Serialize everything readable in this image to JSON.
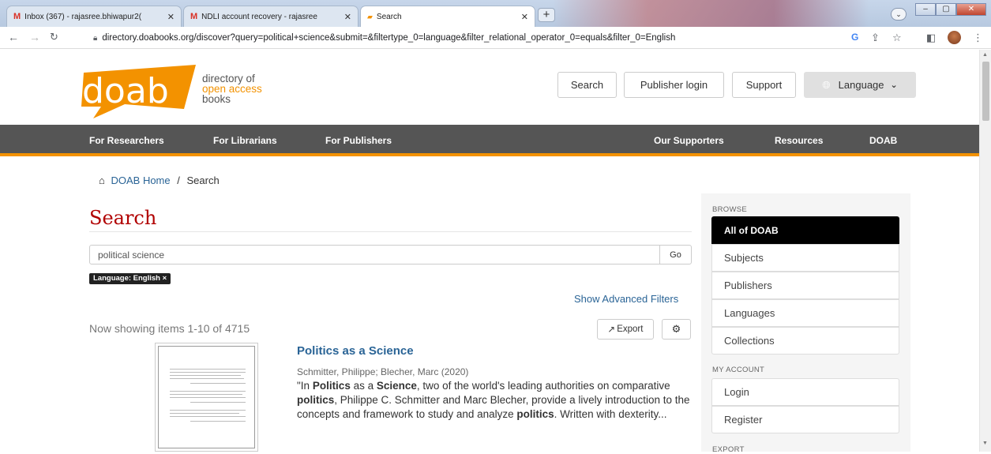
{
  "browser": {
    "tabs": [
      {
        "icon": "gmail-icon",
        "label": "Inbox (367) - rajasree.bhiwapur2(",
        "close": "✕"
      },
      {
        "icon": "gmail-icon",
        "label": "NDLI account recovery - rajasree",
        "close": "✕"
      },
      {
        "icon": "doab-favicon",
        "label": "Search",
        "close": "✕"
      }
    ],
    "new_tab": "+",
    "url": "directory.doabooks.org/discover?query=political+science&submit=&filtertype_0=language&filter_relational_operator_0=equals&filter_0=English"
  },
  "logo": {
    "wordmark": "doab",
    "line1": "directory of",
    "line2": "open access",
    "line3": "books",
    "color": "#f39200"
  },
  "header": {
    "search": "Search",
    "publisher_login": "Publisher login",
    "support": "Support",
    "language": "Language"
  },
  "nav": {
    "researchers": "For Researchers",
    "librarians": "For Librarians",
    "publishers": "For Publishers",
    "supporters": "Our Supporters",
    "resources": "Resources",
    "doab": "DOAB"
  },
  "breadcrumb": {
    "home": "DOAB Home",
    "sep": "/",
    "current": "Search"
  },
  "main": {
    "title": "Search",
    "query": "political science",
    "go": "Go",
    "filter_badge": "Language: English ×",
    "advanced": "Show Advanced Filters",
    "showing": "Now showing items 1-10 of 4715",
    "export": "Export"
  },
  "result": {
    "title": "Politics as a Science",
    "author": "Schmitter, Philippe; Blecher, Marc (2020)",
    "abstract_parts": [
      {
        "t": "\"In ",
        "b": false
      },
      {
        "t": "Politics",
        "b": true
      },
      {
        "t": " as a ",
        "b": false
      },
      {
        "t": "Science",
        "b": true
      },
      {
        "t": ", two of the world's leading authorities on comparative ",
        "b": false
      },
      {
        "t": "politics",
        "b": true
      },
      {
        "t": ", Philippe C. Schmitter and Marc Blecher, provide a lively introduction to the concepts and framework to study and analyze ",
        "b": false
      },
      {
        "t": "politics",
        "b": true
      },
      {
        "t": ". Written with dexterity...",
        "b": false
      }
    ]
  },
  "sidebar": {
    "browse_head": "BROWSE",
    "browse": [
      "All of DOAB",
      "Subjects",
      "Publishers",
      "Languages",
      "Collections"
    ],
    "account_head": "MY ACCOUNT",
    "account": [
      "Login",
      "Register"
    ],
    "export_head": "EXPORT"
  },
  "colors": {
    "accent": "#f39200",
    "link": "#2a6496",
    "title": "#b10000",
    "nav": "#555555"
  }
}
